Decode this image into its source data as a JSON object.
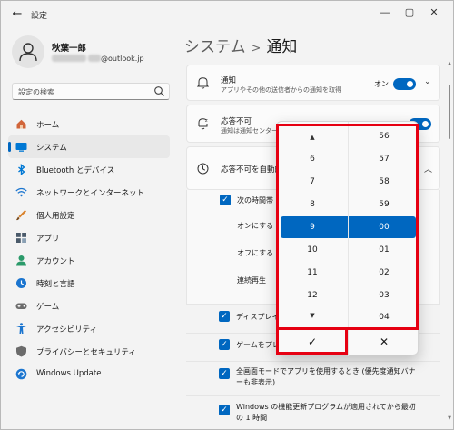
{
  "titlebar": {
    "back_icon": "back-arrow-icon",
    "title": "設定"
  },
  "profile": {
    "name": "秋葉一郎",
    "email_suffix": "@outlook.jp"
  },
  "search": {
    "placeholder": "設定の検索"
  },
  "nav": {
    "items": [
      {
        "label": "ホーム",
        "icon": "home-icon",
        "color": "#c0562b"
      },
      {
        "label": "システム",
        "icon": "system-icon",
        "color": "#0078d4",
        "selected": true
      },
      {
        "label": "Bluetooth とデバイス",
        "icon": "bluetooth-icon",
        "color": "#0078d4"
      },
      {
        "label": "ネットワークとインターネット",
        "icon": "network-icon",
        "color": "#1b75cf"
      },
      {
        "label": "個人用設定",
        "icon": "personalize-icon",
        "color": "#d9822b"
      },
      {
        "label": "アプリ",
        "icon": "apps-icon",
        "color": "#4a5a6a"
      },
      {
        "label": "アカウント",
        "icon": "account-icon",
        "color": "#2b9a6a"
      },
      {
        "label": "時刻と言語",
        "icon": "time-language-icon",
        "color": "#1b75cf"
      },
      {
        "label": "ゲーム",
        "icon": "game-icon",
        "color": "#6b6b6b"
      },
      {
        "label": "アクセシビリティ",
        "icon": "accessibility-icon",
        "color": "#1b75cf"
      },
      {
        "label": "プライバシーとセキュリティ",
        "icon": "privacy-icon",
        "color": "#6b6b6b"
      },
      {
        "label": "Windows Update",
        "icon": "windows-update-icon",
        "color": "#1b75cf"
      }
    ]
  },
  "main": {
    "breadcrumb_parent": "システム",
    "breadcrumb_sep": ">",
    "breadcrumb_current": "通知",
    "notifications": {
      "title": "通知",
      "desc": "アプリやその他の送信者からの通知を取得",
      "toggle_label": "オン"
    },
    "dnd": {
      "title": "応答不可",
      "desc": "通知は通知センター"
    },
    "auto_dnd": {
      "title": "応答不可を自動的"
    },
    "schedule": {
      "checkbox_label": "次の時間帯",
      "on_label": "オンにする",
      "off_label": "オフにする",
      "repeat_label": "連続再生"
    },
    "display_dup": "ディスプレイを",
    "gaming": "ゲームをプレイ",
    "fullscreen": "全画面モードでアプリを使用するとき (優先度通知バナーも非表示)",
    "update": "Windows の機能更新プログラムが適用されてから最初の 1 時間"
  },
  "picker": {
    "hours": [
      "6",
      "7",
      "8",
      "9",
      "10",
      "11",
      "12"
    ],
    "minutes": [
      "56",
      "57",
      "58",
      "59",
      "00",
      "01",
      "02",
      "03",
      "04"
    ],
    "selected_hour": "9",
    "selected_minute": "00",
    "up_icon": "arrow-up-icon",
    "down_icon": "arrow-down-icon",
    "accept_glyph": "✓",
    "cancel_glyph": "✕"
  },
  "colors": {
    "accent": "#0067c0",
    "highlight_box": "#e60012"
  }
}
